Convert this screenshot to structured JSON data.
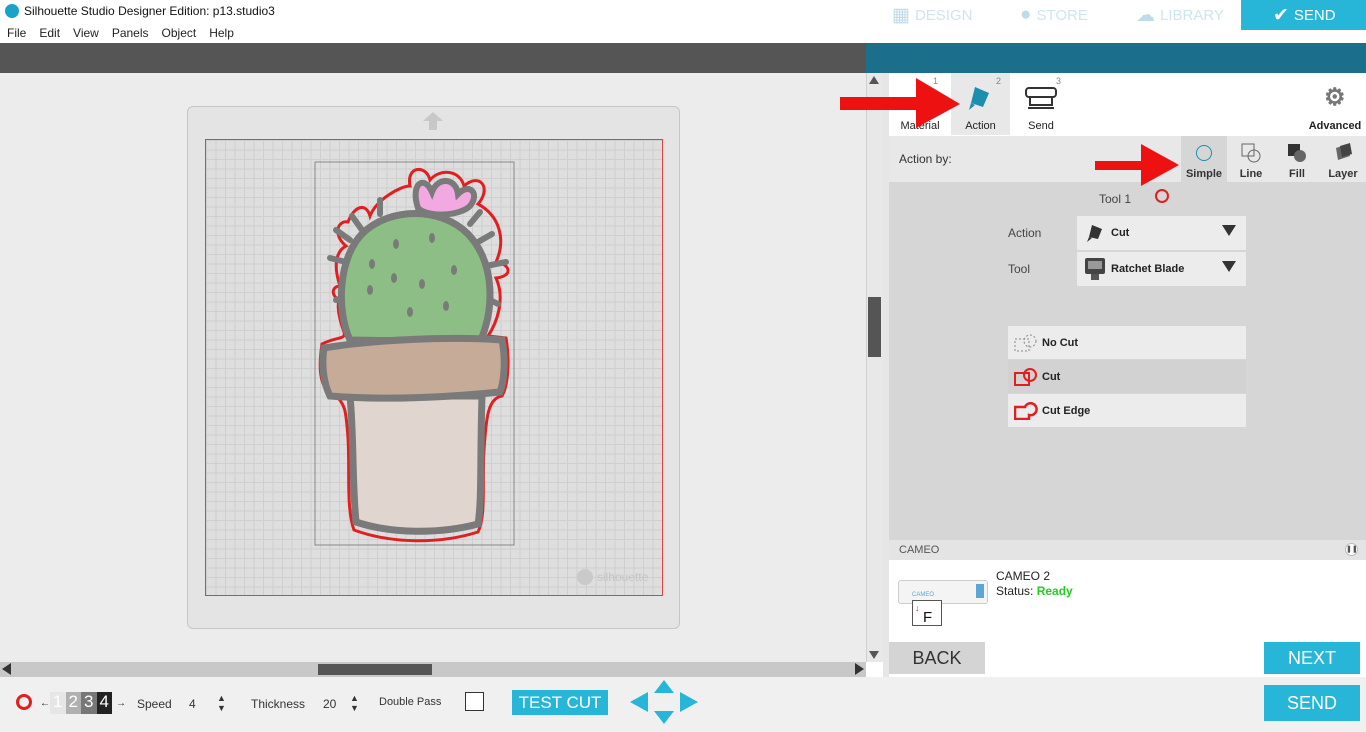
{
  "window": {
    "title": "Silhouette Studio Designer Edition: p13.studio3",
    "minimize": "—",
    "restore": "❐",
    "close": "✕"
  },
  "menu": [
    "File",
    "Edit",
    "View",
    "Panels",
    "Object",
    "Help"
  ],
  "top_tabs": {
    "design": "DESIGN",
    "store": "STORE",
    "library": "LIBRARY",
    "send": "SEND"
  },
  "send_tabs": {
    "material": "Material",
    "action": "Action",
    "send": "Send",
    "advanced": "Advanced",
    "n1": "1",
    "n2": "2",
    "n3": "3"
  },
  "action_by": {
    "label": "Action by:",
    "simple": "Simple",
    "line": "Line",
    "fill": "Fill",
    "layer": "Layer"
  },
  "tool": {
    "header": "Tool 1",
    "action_label": "Action",
    "action_value": "Cut",
    "tool_label": "Tool",
    "tool_value": "Ratchet Blade"
  },
  "cut_options": [
    "No Cut",
    "Cut",
    "Cut Edge"
  ],
  "device": {
    "section": "CAMEO",
    "name": "CAMEO 2",
    "status_label": "Status:",
    "status_value": "Ready",
    "status_color": "#22cc22",
    "icon_letter": "F",
    "mini_label": "CAMEO"
  },
  "buttons": {
    "back": "BACK",
    "next": "NEXT",
    "send": "SEND",
    "test_cut": "TEST CUT"
  },
  "watermark": "silhouette",
  "bottom": {
    "digits": [
      "1",
      "2",
      "3",
      "4"
    ],
    "speed_label": "Speed",
    "speed_value": "4",
    "thickness_label": "Thickness",
    "thickness_value": "20",
    "double_pass_label": "Double Pass"
  },
  "colors": {
    "accent": "#28b6d8",
    "tab_bg": "#1b6f8b",
    "cut_red": "#e02020",
    "cactus_green": "#8dbe85",
    "flower_pink": "#f2a8e0",
    "pot_rim": "#c6ab98",
    "pot_body": "#e0d5cf"
  }
}
